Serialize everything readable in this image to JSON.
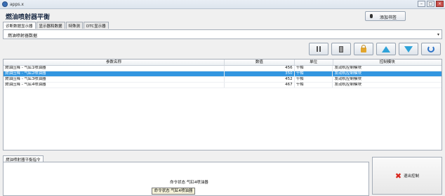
{
  "window": {
    "title": "apps.x"
  },
  "header": {
    "title": "燃油喷射器平衡",
    "add_button": "添加书签"
  },
  "tabs": [
    "诊断数据显示器",
    "显示器和数据",
    "特殊测",
    "DTC显示器"
  ],
  "selector": {
    "value": "燃油喷射器数据"
  },
  "table": {
    "headers": [
      "参数名称",
      "数值",
      "单位",
      "控制模块"
    ],
    "rows": [
      {
        "name": "燃油压降 - 气缸1喷油器",
        "value": "456",
        "unit": "千帕",
        "module": "发动机控制模块"
      },
      {
        "name": "燃油压降 - 气缸2喷油器",
        "value": "350",
        "unit": "千帕",
        "module": "发动机控制模块"
      },
      {
        "name": "燃油压降 - 气缸3喷油器",
        "value": "452",
        "unit": "千帕",
        "module": "发动机控制模块"
      },
      {
        "name": "燃油压降 - 气缸4喷油器",
        "value": "467",
        "unit": "千帕",
        "module": "发动机控制模块"
      }
    ]
  },
  "panel": {
    "tab": "燃油喷射器平衡指令",
    "status": "命令状态 气缸4喷油器",
    "button": "命令状态 气缸4喷油器"
  },
  "exit_button": "退出控制",
  "colors": {
    "selected_row": "#3296e0",
    "exit_icon": "#d9261c"
  }
}
